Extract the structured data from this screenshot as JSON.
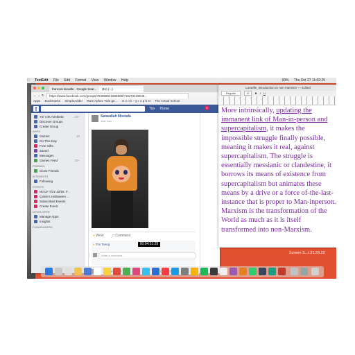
{
  "menubar": {
    "apple": "",
    "items": [
      "TextEdit",
      "File",
      "Edit",
      "Format",
      "View",
      "Window",
      "Help"
    ],
    "clock": "Thu Oct 27  11:02:25",
    "battery": "93%"
  },
  "browser": {
    "tabs": [
      "francois laruelle - Google Sear...",
      "(11) (...)"
    ],
    "url": "https://www.facebook.com/groups/783998941688888/?16272138048...",
    "bookmarks": [
      "Apps",
      "Bookmarks",
      "SimpleAdder",
      "Rare Aphex Twin ge...",
      "m o n k ~ p r o p h et",
      "The Actual School"
    ]
  },
  "facebook": {
    "logo": "f",
    "nav_user": "Tim",
    "nav_home": "Home",
    "badge": "5",
    "sidebar": {
      "top_items": [
        {
          "label": "Yo! VJK Aesthetic",
          "count": "20+"
        },
        {
          "label": "Discover Groups",
          "count": ""
        },
        {
          "label": "Create Group",
          "count": ""
        }
      ],
      "apps_header": "APPS",
      "apps": [
        {
          "label": "Games",
          "count": "10"
        },
        {
          "label": "On This Day",
          "count": ""
        },
        {
          "label": "Free Gifts",
          "count": ""
        },
        {
          "label": "Saved",
          "count": ""
        },
        {
          "label": "Messages",
          "count": ""
        },
        {
          "label": "Games Feed",
          "count": "20+"
        }
      ],
      "friends_header": "FRIENDS",
      "friends": [
        {
          "label": "Close Friends"
        }
      ],
      "interests_header": "INTERESTS",
      "interests": [
        {
          "label": "Following"
        }
      ],
      "events_header": "EVENTS",
      "events": [
        {
          "label": "NCCP 7/21-10/16: F..."
        },
        {
          "label": "Calvin's Halloween ..."
        },
        {
          "label": "Subscribed Events"
        },
        {
          "label": "Create Event"
        }
      ],
      "developer_header": "DEVELOPER",
      "developer": [
        {
          "label": "Manage Apps"
        },
        {
          "label": "Insights"
        }
      ],
      "fundraisers_header": "FUNDRAISERS"
    },
    "post": {
      "author": "Sanaullah Mostafa",
      "time": "Just now",
      "actions": [
        "Wow",
        "Comment"
      ],
      "reaction_name": "Tim Tseng",
      "comment_placeholder": "Write a comment...",
      "chat_user": "Perch Ee",
      "chat_label": "Chat (39)"
    }
  },
  "video_timestamp": "00:04:31:29",
  "textedit": {
    "title": "Laruelle_introduction to non-marxism — Edited",
    "toolbar": [
      "Regular",
      "12",
      "B",
      "I",
      "U"
    ],
    "body_pre": "More intrinsically, ",
    "body_link": "updating the immanent link of Man-in-person and supercapitalism",
    "body_post": ", it makes the impossible struggle finally possible, meaning it makes it real, against supercapitalism. The struggle is essentially messianic or clandestine, it borrows its means of existence from supercapitalism but animates these means by a drive or a force of-the-last-instance that is proper to Man-inperson. Marxism is the transformation of the World as much as it is itself transformed into non-Marxism."
  },
  "desktop": {
    "screenshot_label": "Screen S...t 21.29.22"
  },
  "colors": {
    "desktop": "#e2502f",
    "facebook_blue": "#3b5998",
    "text_purple": "#7a2a9e"
  }
}
